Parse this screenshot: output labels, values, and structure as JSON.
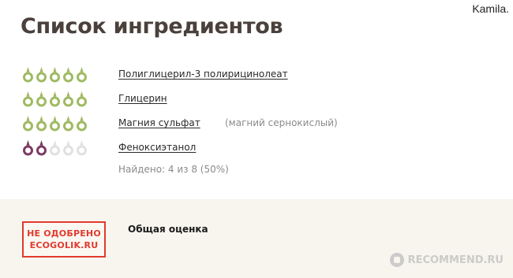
{
  "user_tag": "Kamila.",
  "title": "Список ингредиентов",
  "colors": {
    "drop_green": "#9fba62",
    "drop_purple": "#7d3a63",
    "drop_empty": "#e1e1e1",
    "stamp_red": "#e23a2e",
    "panel_bg": "#f8f5ef"
  },
  "ingredients": [
    {
      "name": "Полиглицерил-3 полирицинолеат",
      "note": "",
      "rating": 5,
      "rating_color": "green"
    },
    {
      "name": "Глицерин",
      "note": "",
      "rating": 5,
      "rating_color": "green"
    },
    {
      "name": "Магния сульфат",
      "note": "(магний сернокислый)",
      "rating": 5,
      "rating_color": "green"
    },
    {
      "name": "Феноксиэтанол",
      "note": "",
      "rating": 2,
      "rating_color": "purple"
    }
  ],
  "found_text": "Найдено: 4 из 8 (50%)",
  "stamp": {
    "line1": "НЕ ОДОБРЕНО",
    "line2": "ECOGOLIK.RU"
  },
  "overall_label": "Общая оценка",
  "watermark": "RECOMMEND.RU"
}
